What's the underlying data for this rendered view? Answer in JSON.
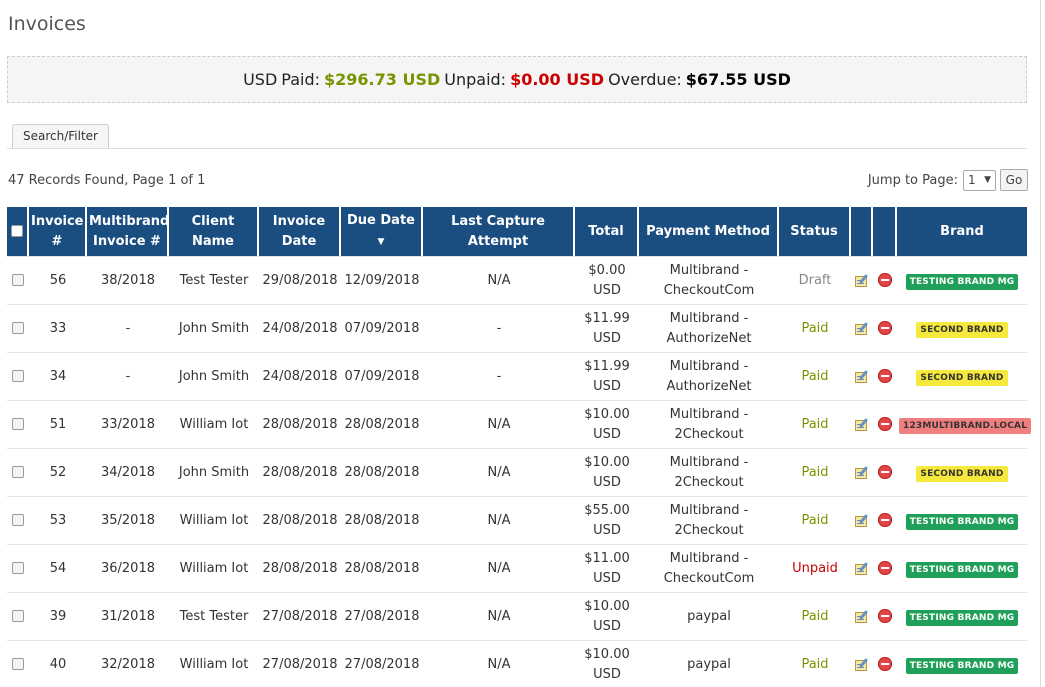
{
  "page_title": "Invoices",
  "summary": {
    "currency": "USD",
    "paid_label": "Paid:",
    "paid_amount": "$296.73 USD",
    "unpaid_label": "Unpaid:",
    "unpaid_amount": "$0.00 USD",
    "overdue_label": "Overdue:",
    "overdue_amount": "$67.55 USD"
  },
  "tabs": {
    "search_filter": "Search/Filter"
  },
  "records_text": "47 Records Found, Page 1 of 1",
  "pager": {
    "jump_label": "Jump to Page:",
    "selected_page": "1",
    "go_label": "Go"
  },
  "columns": {
    "invoice_num": "Invoice #",
    "multibrand_invoice": "Multibrand Invoice #",
    "client_name": "Client Name",
    "invoice_date": "Invoice Date",
    "due_date": "Due Date",
    "last_capture": "Last Capture Attempt",
    "total": "Total",
    "payment_method": "Payment Method",
    "status": "Status",
    "brand": "Brand"
  },
  "colors": {
    "header_bg": "#1a4d80",
    "paid": "#779500",
    "unpaid": "#cc0000",
    "draft": "#888888"
  },
  "rows": [
    {
      "invoice": "56",
      "mb_invoice": "38/2018",
      "client": "Test Tester",
      "invoice_date": "29/08/2018",
      "due_date": "12/09/2018",
      "last_capture": "N/A",
      "total_amount": "$0.00",
      "total_currency": "USD",
      "payment_line1": "Multibrand -",
      "payment_line2": "CheckoutCom",
      "status": "Draft",
      "status_type": "draft",
      "brand": "TESTING BRAND MG",
      "brand_bg": "#1fa05a",
      "brand_fg": "#ffffff"
    },
    {
      "invoice": "33",
      "mb_invoice": "-",
      "client": "John Smith",
      "invoice_date": "24/08/2018",
      "due_date": "07/09/2018",
      "last_capture": "-",
      "total_amount": "$11.99",
      "total_currency": "USD",
      "payment_line1": "Multibrand -",
      "payment_line2": "AuthorizeNet",
      "status": "Paid",
      "status_type": "paid",
      "brand": "SECOND BRAND",
      "brand_bg": "#f7e93b",
      "brand_fg": "#333333"
    },
    {
      "invoice": "34",
      "mb_invoice": "-",
      "client": "John Smith",
      "invoice_date": "24/08/2018",
      "due_date": "07/09/2018",
      "last_capture": "-",
      "total_amount": "$11.99",
      "total_currency": "USD",
      "payment_line1": "Multibrand -",
      "payment_line2": "AuthorizeNet",
      "status": "Paid",
      "status_type": "paid",
      "brand": "SECOND BRAND",
      "brand_bg": "#f7e93b",
      "brand_fg": "#333333"
    },
    {
      "invoice": "51",
      "mb_invoice": "33/2018",
      "client": "William Iot",
      "invoice_date": "28/08/2018",
      "due_date": "28/08/2018",
      "last_capture": "N/A",
      "total_amount": "$10.00",
      "total_currency": "USD",
      "payment_line1": "Multibrand -",
      "payment_line2": "2Checkout",
      "status": "Paid",
      "status_type": "paid",
      "brand": "123MULTIBRAND.LOCAL",
      "brand_bg": "#f08080",
      "brand_fg": "#333333"
    },
    {
      "invoice": "52",
      "mb_invoice": "34/2018",
      "client": "John Smith",
      "invoice_date": "28/08/2018",
      "due_date": "28/08/2018",
      "last_capture": "N/A",
      "total_amount": "$10.00",
      "total_currency": "USD",
      "payment_line1": "Multibrand -",
      "payment_line2": "2Checkout",
      "status": "Paid",
      "status_type": "paid",
      "brand": "SECOND BRAND",
      "brand_bg": "#f7e93b",
      "brand_fg": "#333333"
    },
    {
      "invoice": "53",
      "mb_invoice": "35/2018",
      "client": "William Iot",
      "invoice_date": "28/08/2018",
      "due_date": "28/08/2018",
      "last_capture": "N/A",
      "total_amount": "$55.00",
      "total_currency": "USD",
      "payment_line1": "Multibrand -",
      "payment_line2": "2Checkout",
      "status": "Paid",
      "status_type": "paid",
      "brand": "TESTING BRAND MG",
      "brand_bg": "#1fa05a",
      "brand_fg": "#ffffff"
    },
    {
      "invoice": "54",
      "mb_invoice": "36/2018",
      "client": "William Iot",
      "invoice_date": "28/08/2018",
      "due_date": "28/08/2018",
      "last_capture": "N/A",
      "total_amount": "$11.00",
      "total_currency": "USD",
      "payment_line1": "Multibrand -",
      "payment_line2": "CheckoutCom",
      "status": "Unpaid",
      "status_type": "unpaid",
      "brand": "TESTING BRAND MG",
      "brand_bg": "#1fa05a",
      "brand_fg": "#ffffff"
    },
    {
      "invoice": "39",
      "mb_invoice": "31/2018",
      "client": "Test Tester",
      "invoice_date": "27/08/2018",
      "due_date": "27/08/2018",
      "last_capture": "N/A",
      "total_amount": "$10.00",
      "total_currency": "USD",
      "payment_line1": "paypal",
      "payment_line2": "",
      "status": "Paid",
      "status_type": "paid",
      "brand": "TESTING BRAND MG",
      "brand_bg": "#1fa05a",
      "brand_fg": "#ffffff"
    },
    {
      "invoice": "40",
      "mb_invoice": "32/2018",
      "client": "William Iot",
      "invoice_date": "27/08/2018",
      "due_date": "27/08/2018",
      "last_capture": "N/A",
      "total_amount": "$10.00",
      "total_currency": "USD",
      "payment_line1": "paypal",
      "payment_line2": "",
      "status": "Paid",
      "status_type": "paid",
      "brand": "TESTING BRAND MG",
      "brand_bg": "#1fa05a",
      "brand_fg": "#ffffff"
    }
  ]
}
